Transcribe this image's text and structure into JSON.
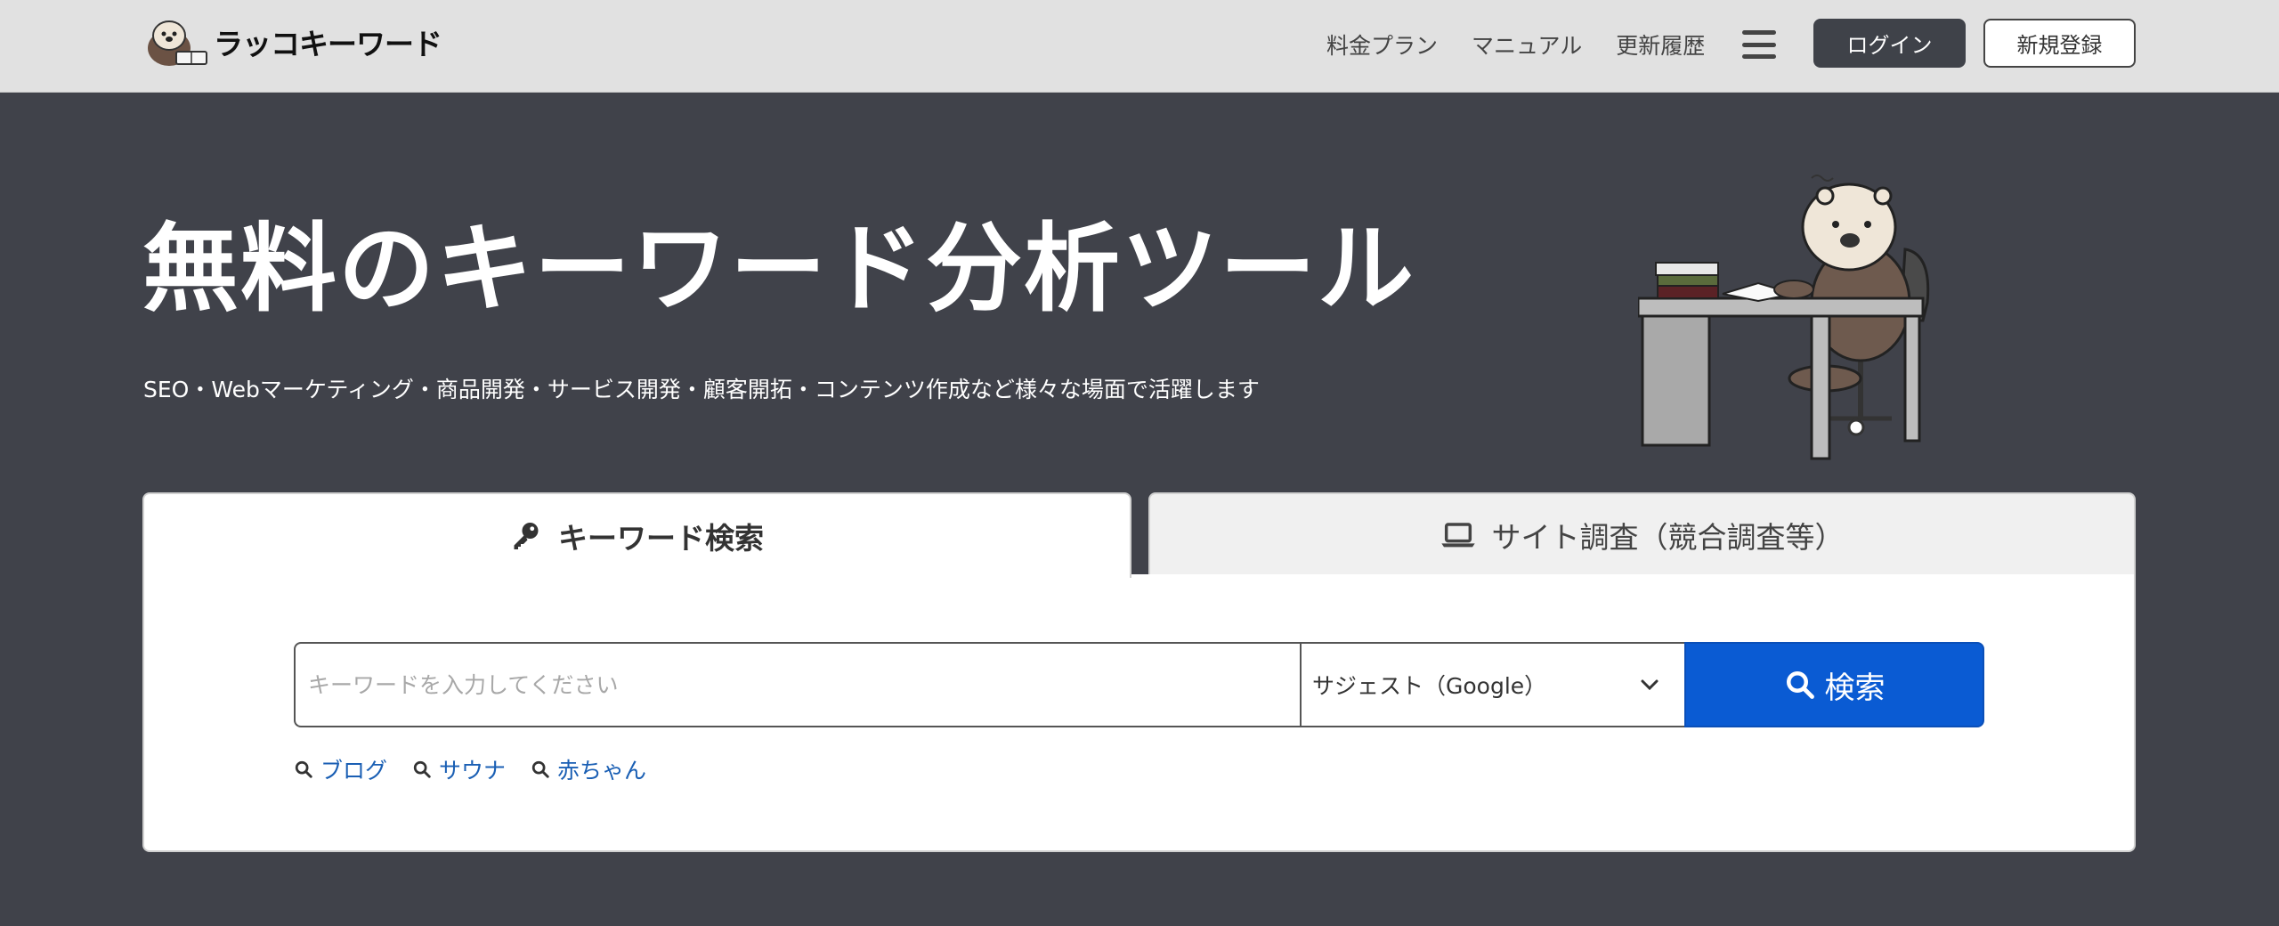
{
  "header": {
    "logo_text": "ラッコキーワード",
    "nav": [
      {
        "label": "料金プラン"
      },
      {
        "label": "マニュアル"
      },
      {
        "label": "更新履歴"
      }
    ],
    "menu_icon": "hamburger-icon",
    "login_label": "ログイン",
    "register_label": "新規登録"
  },
  "hero": {
    "title": "無料のキーワード分析ツール",
    "subtitle": "SEO・Webマーケティング・商品開発・サービス開発・顧客開拓・コンテンツ作成など様々な場面で活躍します"
  },
  "tabs": [
    {
      "label": "キーワード検索",
      "icon": "key-icon",
      "active": true
    },
    {
      "label": "サイト調査（競合調査等）",
      "icon": "laptop-icon",
      "active": false
    }
  ],
  "search": {
    "placeholder": "キーワードを入力してください",
    "value": "",
    "engine_selected": "サジェスト（Google）",
    "button_label": "検索"
  },
  "examples": [
    {
      "label": "ブログ"
    },
    {
      "label": "サウナ"
    },
    {
      "label": "赤ちゃん"
    }
  ],
  "colors": {
    "hero_bg": "#40424a",
    "header_bg": "#e1e1e1",
    "primary_button": "#0a5bd3",
    "link": "#1a5fb4"
  }
}
